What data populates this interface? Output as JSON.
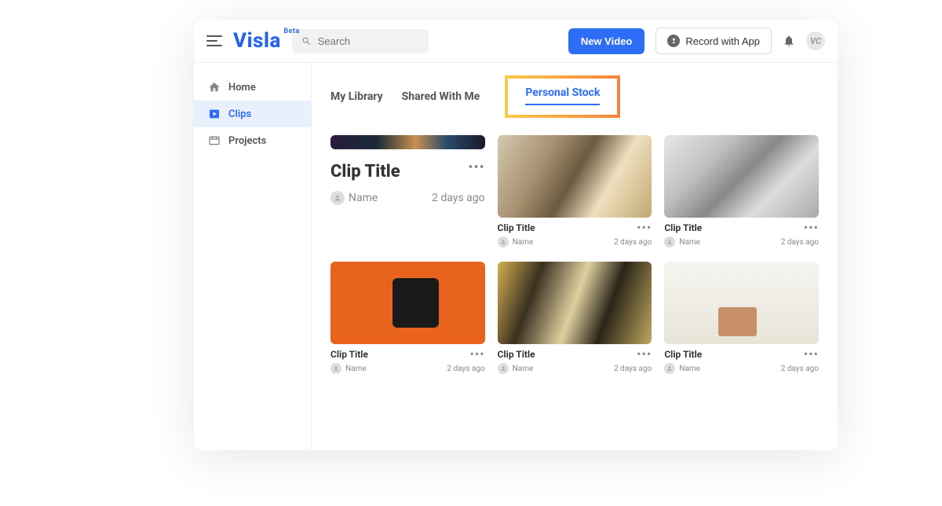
{
  "header": {
    "logo_text": "Visla",
    "logo_badge": "Beta",
    "search_placeholder": "Search",
    "new_video_label": "New Video",
    "record_label": "Record with App"
  },
  "sidebar": {
    "items": [
      {
        "label": "Home",
        "icon": "home"
      },
      {
        "label": "Clips",
        "icon": "clip",
        "active": true
      },
      {
        "label": "Projects",
        "icon": "projects"
      }
    ]
  },
  "tabs": [
    {
      "label": "My Library"
    },
    {
      "label": "Shared With Me"
    },
    {
      "label": "Personal Stock",
      "active": true
    }
  ],
  "clips": [
    {
      "title": "Clip Title",
      "author": "Name",
      "time": "2 days ago",
      "featured": true
    },
    {
      "title": "Clip Title",
      "author": "Name",
      "time": "2 days ago"
    },
    {
      "title": "Clip Title",
      "author": "Name",
      "time": "2 days ago"
    },
    {
      "title": "Clip Title",
      "author": "Name",
      "time": "2 days ago"
    },
    {
      "title": "Clip Title",
      "author": "Name",
      "time": "2 days ago"
    },
    {
      "title": "Clip Title",
      "author": "Name",
      "time": "2 days ago"
    }
  ]
}
